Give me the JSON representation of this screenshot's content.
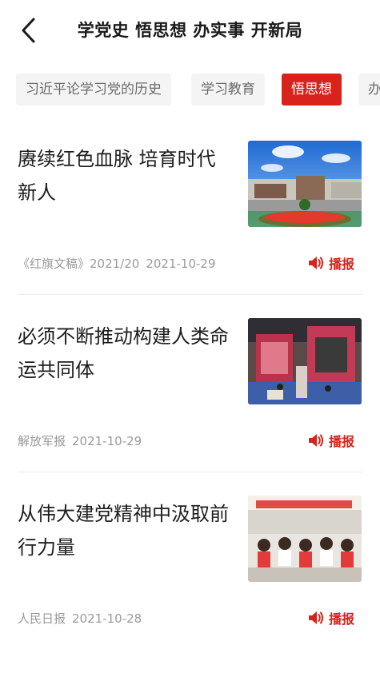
{
  "header": {
    "title": "学党史 悟思想 办实事 开新局",
    "back_icon": "chevron-left-icon"
  },
  "tabs": [
    {
      "label": "习近平论学习党的历史",
      "active": false
    },
    {
      "label": "学习教育",
      "active": false
    },
    {
      "label": "悟思想",
      "active": true
    },
    {
      "label": "办实事",
      "active": false
    }
  ],
  "articles": [
    {
      "title": "赓续红色血脉 培育时代新人",
      "source": "《红旗文稿》2021/20",
      "date": "2021-10-29",
      "play_label": "播报",
      "thumb": "building-photo"
    },
    {
      "title": "必须不断推动构建人类命运共同体",
      "source": "解放军报",
      "date": "2021-10-29",
      "play_label": "播报",
      "thumb": "exhibition-photo"
    },
    {
      "title": "从伟大建党精神中汲取前行力量",
      "source": "人民日报",
      "date": "2021-10-28",
      "play_label": "播报",
      "thumb": "classroom-photo"
    }
  ],
  "colors": {
    "accent": "#d7231c",
    "tab_bg": "#f4f4f4",
    "meta_text": "#9a9a9a"
  }
}
